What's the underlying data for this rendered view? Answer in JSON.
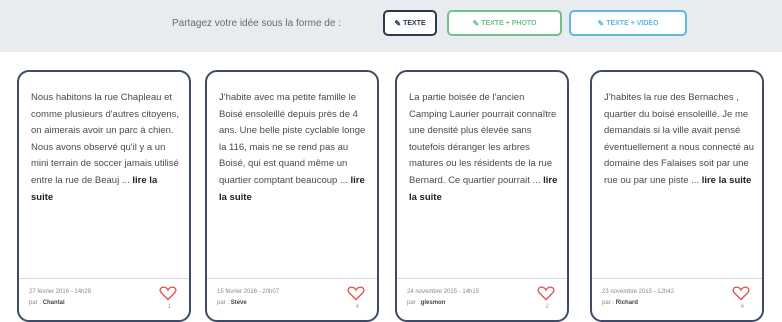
{
  "share": {
    "label": "Partagez votre idée sous la forme de :",
    "buttons": [
      {
        "label": "TEXTE",
        "icon": "pencil-icon"
      },
      {
        "label": "TEXTE + PHOTO",
        "icon": "photo-icon"
      },
      {
        "label": "TEXTE + VIDÉO",
        "icon": "video-icon"
      }
    ]
  },
  "colors": {
    "texte": "#2a3a55",
    "photo": "#6fc18a",
    "video": "#5eb8e0",
    "card_border": "#3e4a66",
    "heart": "#e05a5a"
  },
  "cards": [
    {
      "text": "Nous habitons la rue Chapleau et comme plusieurs d'autres citoyens, on aimerais avoir un parc à chien. Nous avons observé qu'il y a un mini terrain de soccer jamais utilisé entre la rue de Beauj ...",
      "more": "lire la suite",
      "date": "27 février 2016 - 14h28",
      "author_prefix": "par :",
      "author": "Chantal",
      "likes": "1"
    },
    {
      "text": "J'habite avec ma petite famille le Boisé ensoleillé depuis près de 4 ans. Une belle piste cyclable longe la 116, mais ne se rend pas au Boisé, qui est quand même un quartier comptant beaucoup ...",
      "more": "lire la suite",
      "date": "15 février 2016 - 20h07",
      "author_prefix": "par :",
      "author": "Steve",
      "likes": "4"
    },
    {
      "text": "La partie boisée de l'ancien Camping Laurier pourrait connaître une densité plus élevée sans toutefois déranger les arbres matures ou les résidents de la rue Bernard. Ce quartier pourrait ...",
      "more": "lire la suite",
      "date": "24 novembre 2015 - 14h15",
      "author_prefix": "par :",
      "author": "glesmon",
      "likes": "2"
    },
    {
      "text": "J'habites la rue des Bernaches , quartier du boisé ensoleillé. Je me demandais si la ville avait pensé éventuellement a nous connecté au domaine des Falaises soit par une rue ou par une piste ...",
      "more": "lire la suite",
      "date": "23 novembre 2015 - 12h42",
      "author_prefix": "par :",
      "author": "Richard",
      "likes": "4"
    }
  ]
}
